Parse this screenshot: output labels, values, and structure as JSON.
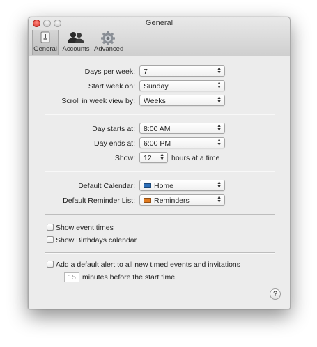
{
  "window": {
    "title": "General"
  },
  "toolbar": {
    "general": "General",
    "accounts": "Accounts",
    "advanced": "Advanced"
  },
  "week": {
    "days_per_week_label": "Days per week:",
    "days_per_week_value": "7",
    "start_week_label": "Start week on:",
    "start_week_value": "Sunday",
    "scroll_label": "Scroll in week view by:",
    "scroll_value": "Weeks"
  },
  "day": {
    "starts_label": "Day starts at:",
    "starts_value": "8:00 AM",
    "ends_label": "Day ends at:",
    "ends_value": "6:00 PM",
    "show_label": "Show:",
    "show_value": "12",
    "show_suffix": "hours at a time"
  },
  "defaults": {
    "calendar_label": "Default Calendar:",
    "calendar_value": "Home",
    "calendar_color": "#2d6fb8",
    "reminder_label": "Default Reminder List:",
    "reminder_value": "Reminders",
    "reminder_color": "#e07a1f"
  },
  "options": {
    "show_event_times": "Show event times",
    "show_event_times_checked": false,
    "show_birthdays": "Show Birthdays calendar",
    "show_birthdays_checked": false
  },
  "alert": {
    "label": "Add a default alert to all new timed events and invitations",
    "checked": false,
    "minutes_value": "15",
    "minutes_suffix": "minutes before the start time"
  },
  "help": {
    "label": "?"
  }
}
